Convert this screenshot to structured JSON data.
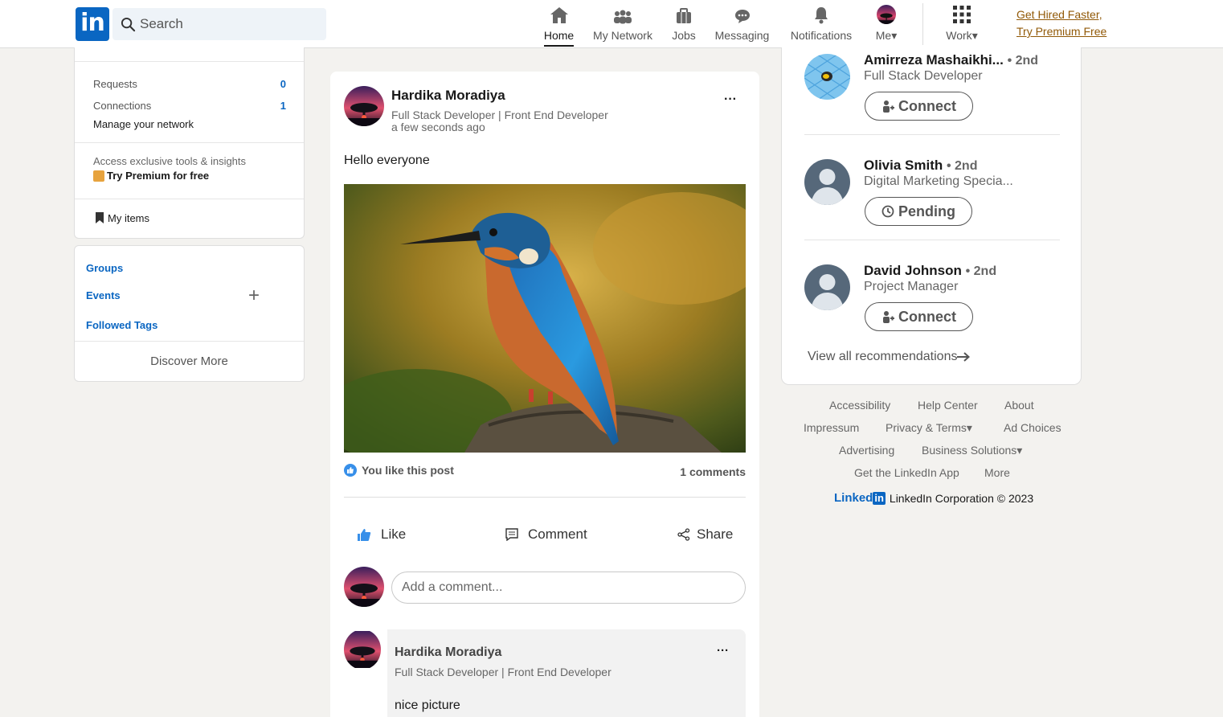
{
  "nav": {
    "logo": "in",
    "search_placeholder": "Search",
    "items": [
      {
        "label": "Home"
      },
      {
        "label": "My Network"
      },
      {
        "label": "Jobs"
      },
      {
        "label": "Messaging"
      },
      {
        "label": "Notifications"
      },
      {
        "label": "Me"
      },
      {
        "label": "Work"
      }
    ],
    "premium_line1": "Get Hired Faster,",
    "premium_line2": "Try Premium Free"
  },
  "left_panel": {
    "requests_label": "Requests",
    "requests_count": "0",
    "connections_label": "Connections",
    "connections_count": "1",
    "manage_label": "Manage your network",
    "access_text": "Access exclusive tools & insights",
    "premium_label": "Try Premium for free",
    "my_items_label": "My items",
    "groups_label": "Groups",
    "events_label": "Events",
    "events_add": "+",
    "followed_tags_label": "Followed Tags",
    "discover_label": "Discover More"
  },
  "post": {
    "author": "Hardika Moradiya",
    "headline": "Full Stack Developer | Front End Developer",
    "time": "a few seconds ago",
    "menu": "···",
    "body": "Hello everyone",
    "reaction_text": "You like this post",
    "comments_count": "1 comments",
    "like_label": "Like",
    "comment_label": "Comment",
    "share_label": "Share",
    "comment_placeholder": "Add a comment...",
    "comment": {
      "author": "Hardika Moradiya",
      "headline": "Full Stack Developer | Front End Developer",
      "text": "nice picture",
      "menu": "···"
    }
  },
  "recommendations": {
    "items": [
      {
        "name": "Amirreza Mashaikhi...",
        "degree": "• 2nd",
        "headline": "Full Stack Developer",
        "button": "Connect"
      },
      {
        "name": "Olivia Smith",
        "degree": "• 2nd",
        "headline": "Digital Marketing Specia...",
        "button": "Pending"
      },
      {
        "name": "David Johnson",
        "degree": "• 2nd",
        "headline": "Project Manager",
        "button": "Connect"
      }
    ],
    "view_all": "View all recommendations"
  },
  "footer": {
    "links": [
      "Accessibility",
      "Help Center",
      "About",
      "Impressum",
      "Privacy & Terms",
      "Ad Choices",
      "Advertising",
      "Business Solutions",
      "Get the LinkedIn App",
      "More"
    ],
    "brand_word": "Linked",
    "brand_box": "in",
    "copyright": "LinkedIn Corporation © 2023"
  },
  "colors": {
    "brand_blue": "#0a66c2",
    "premium_gold": "#915907",
    "background": "#f3f2ef"
  }
}
